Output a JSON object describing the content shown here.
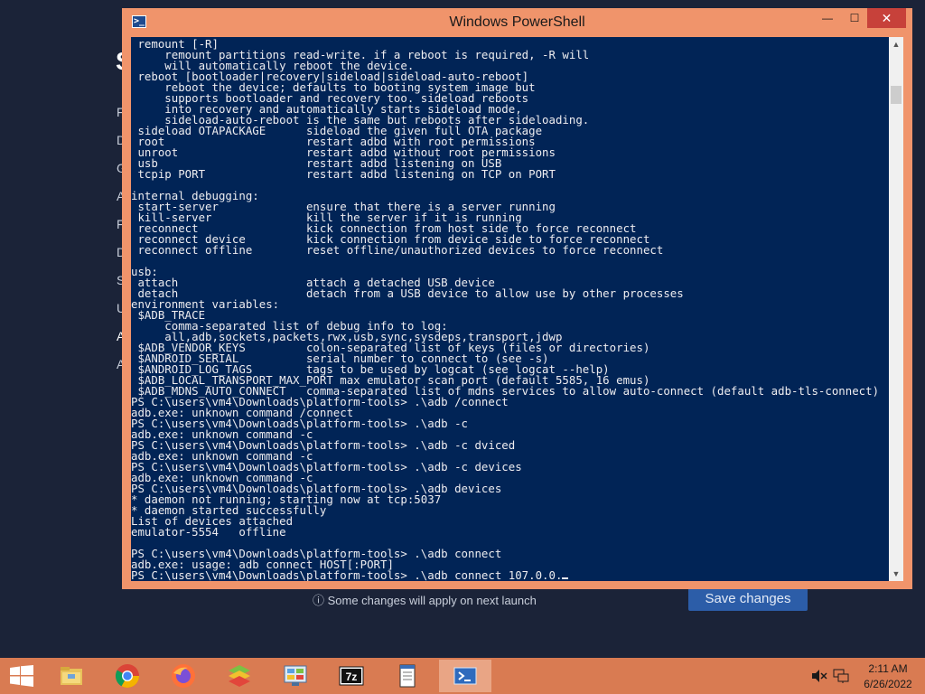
{
  "background_app": {
    "title_initial": "S",
    "nav_initials": [
      "F",
      "D",
      "G",
      "A",
      "F",
      "D",
      "S",
      "U",
      "A",
      "A"
    ],
    "footer_note": "ⓘ Some changes will apply on next launch",
    "save_label": "Save changes"
  },
  "window": {
    "title": "Windows PowerShell",
    "icon_label": ">_",
    "minimize_glyph": "—",
    "maximize_glyph": "☐",
    "close_glyph": "✕"
  },
  "console": {
    "lines": [
      " remount [-R]",
      "     remount partitions read-write. if a reboot is required, -R will",
      "     will automatically reboot the device.",
      " reboot [bootloader|recovery|sideload|sideload-auto-reboot]",
      "     reboot the device; defaults to booting system image but",
      "     supports bootloader and recovery too. sideload reboots",
      "     into recovery and automatically starts sideload mode,",
      "     sideload-auto-reboot is the same but reboots after sideloading.",
      " sideload OTAPACKAGE      sideload the given full OTA package",
      " root                     restart adbd with root permissions",
      " unroot                   restart adbd without root permissions",
      " usb                      restart adbd listening on USB",
      " tcpip PORT               restart adbd listening on TCP on PORT",
      "",
      "internal debugging:",
      " start-server             ensure that there is a server running",
      " kill-server              kill the server if it is running",
      " reconnect                kick connection from host side to force reconnect",
      " reconnect device         kick connection from device side to force reconnect",
      " reconnect offline        reset offline/unauthorized devices to force reconnect",
      "",
      "usb:",
      " attach                   attach a detached USB device",
      " detach                   detach from a USB device to allow use by other processes",
      "environment variables:",
      " $ADB_TRACE",
      "     comma-separated list of debug info to log:",
      "     all,adb,sockets,packets,rwx,usb,sync,sysdeps,transport,jdwp",
      " $ADB_VENDOR_KEYS         colon-separated list of keys (files or directories)",
      " $ANDROID_SERIAL          serial number to connect to (see -s)",
      " $ANDROID_LOG_TAGS        tags to be used by logcat (see logcat --help)",
      " $ADB_LOCAL_TRANSPORT_MAX_PORT max emulator scan port (default 5585, 16 emus)",
      " $ADB_MDNS_AUTO_CONNECT   comma-separated list of mdns services to allow auto-connect (default adb-tls-connect)",
      "PS C:\\users\\vm4\\Downloads\\platform-tools> .\\adb /connect",
      "adb.exe: unknown command /connect",
      "PS C:\\users\\vm4\\Downloads\\platform-tools> .\\adb -c",
      "adb.exe: unknown command -c",
      "PS C:\\users\\vm4\\Downloads\\platform-tools> .\\adb -c dviced",
      "adb.exe: unknown command -c",
      "PS C:\\users\\vm4\\Downloads\\platform-tools> .\\adb -c devices",
      "adb.exe: unknown command -c",
      "PS C:\\users\\vm4\\Downloads\\platform-tools> .\\adb devices",
      "* daemon not running; starting now at tcp:5037",
      "* daemon started successfully",
      "List of devices attached",
      "emulator-5554   offline",
      "",
      "PS C:\\users\\vm4\\Downloads\\platform-tools> .\\adb connect",
      "adb.exe: usage: adb connect HOST[:PORT]"
    ],
    "current_prompt": "PS C:\\users\\vm4\\Downloads\\platform-tools> ",
    "current_input": ".\\adb connect 107.0.0."
  },
  "taskbar": {
    "items": [
      "file-explorer",
      "chrome",
      "firefox",
      "bluestacks",
      "control-panel",
      "7zip",
      "notepad",
      "powershell"
    ],
    "active_item": "powershell",
    "clock_time": "2:11 AM",
    "clock_date": "6/26/2022"
  }
}
